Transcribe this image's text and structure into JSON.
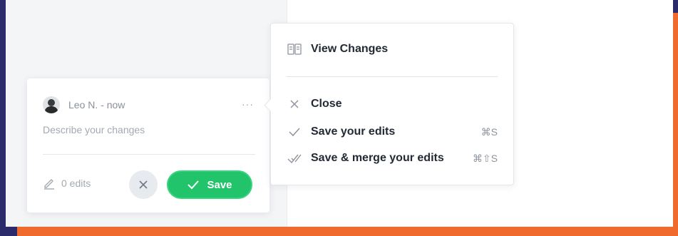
{
  "comment": {
    "author": "Leo N. - now",
    "more_label": "···",
    "placeholder": "Describe your changes",
    "edits_count": "0 edits",
    "save_label": "Save"
  },
  "menu": {
    "view_changes": "View Changes",
    "close": "Close",
    "save_edits": "Save your edits",
    "save_edits_shortcut": "⌘S",
    "save_merge": "Save & merge your edits",
    "save_merge_shortcut": "⌘⇧S"
  },
  "icons": {
    "view": "book-icon",
    "close": "close-icon",
    "check": "check-icon",
    "double_check": "double-check-icon",
    "pencil": "pencil-icon"
  },
  "colors": {
    "save_green": "#21c46b",
    "border_purple": "#2b2a6b",
    "border_orange": "#ef6a2c"
  }
}
